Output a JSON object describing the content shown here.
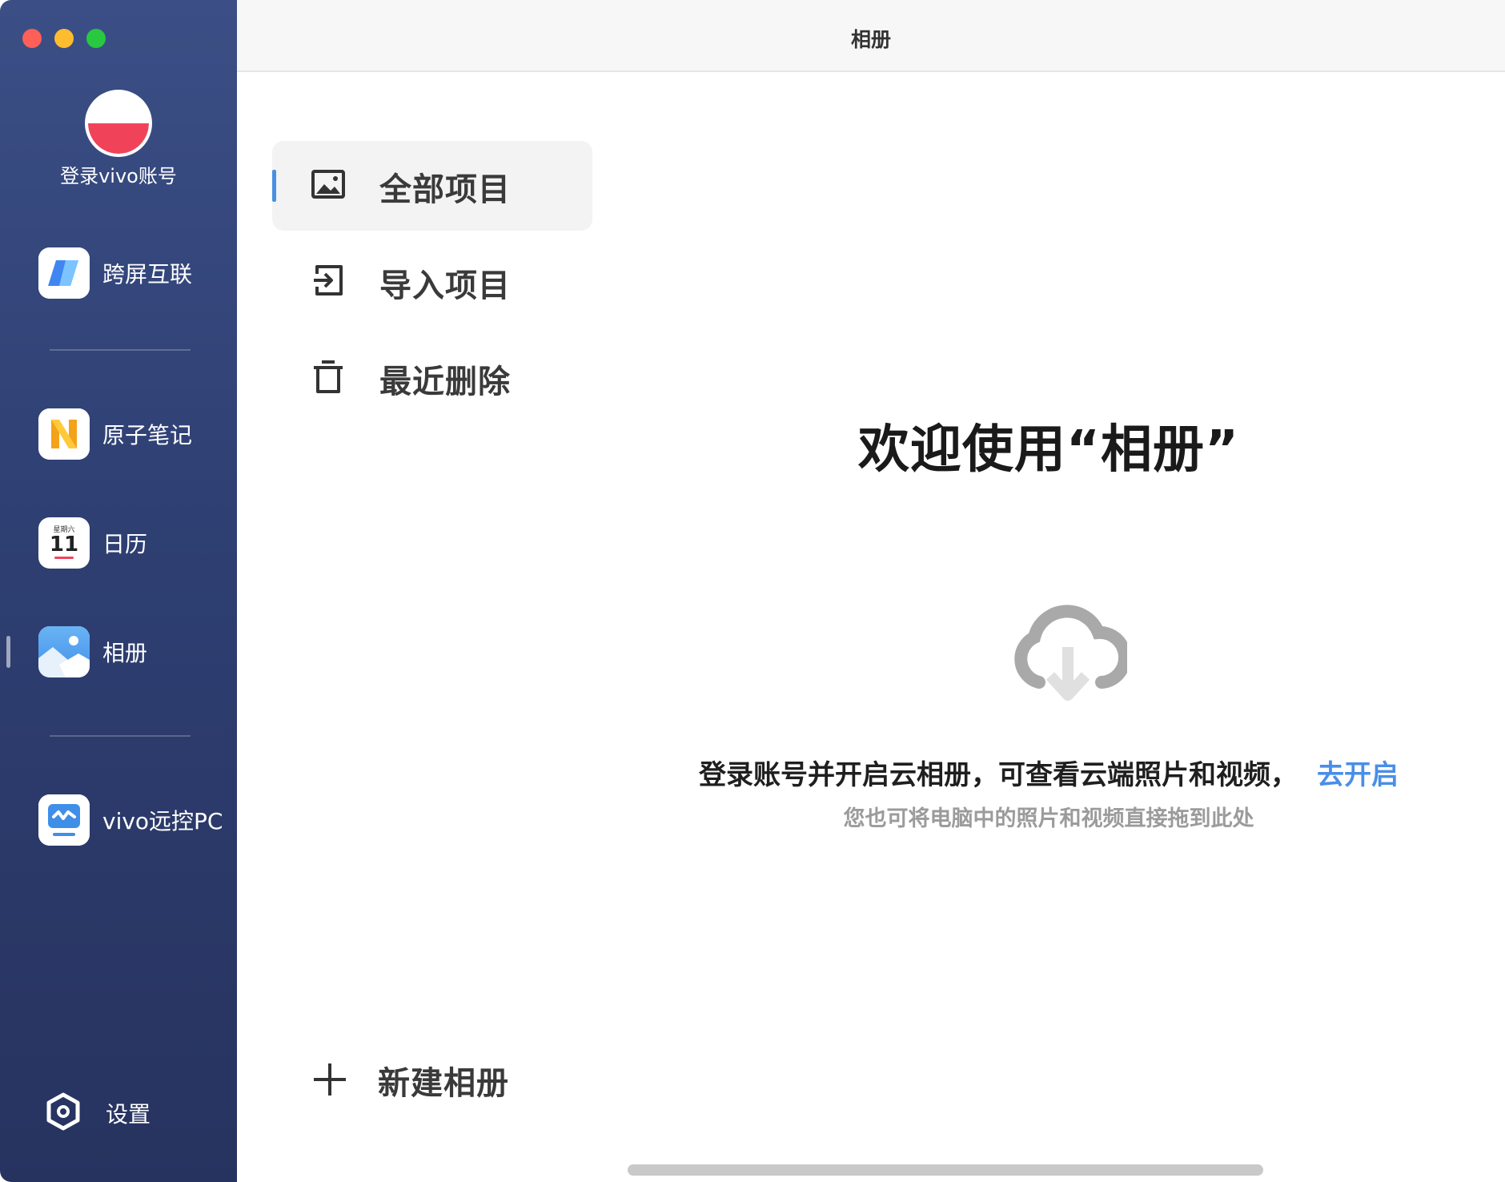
{
  "window": {
    "title": "相册",
    "controls": [
      "close",
      "minimize",
      "zoom"
    ]
  },
  "colors": {
    "sidebar_top": "#3b4f86",
    "sidebar_bottom": "#27335f",
    "accent_link": "#4a8ee8",
    "selection_bar": "#4a90e2"
  },
  "sidebar": {
    "account_label": "登录vivo账号",
    "items": [
      {
        "label": "跨屏互联",
        "icon": "cross-screen-icon"
      },
      {
        "label": "原子笔记",
        "icon": "atom-notes-icon"
      },
      {
        "label": "日历",
        "icon": "calendar-icon",
        "calendar_weekday": "星期六",
        "calendar_day": "11"
      },
      {
        "label": "相册",
        "icon": "photos-icon",
        "active": true
      },
      {
        "label": "vivo远控PC",
        "icon": "remote-pc-icon"
      }
    ],
    "settings_label": "设置"
  },
  "albums": {
    "items": [
      {
        "label": "全部项目",
        "icon": "image-icon",
        "selected": true
      },
      {
        "label": "导入项目",
        "icon": "import-icon"
      },
      {
        "label": "最近删除",
        "icon": "trash-icon"
      }
    ],
    "new_album_label": "新建相册"
  },
  "main": {
    "welcome_title": "欢迎使用“相册”",
    "prompt_text": "登录账号并开启云相册，可查看云端照片和视频，",
    "prompt_link": "去开启",
    "sub_text": "您也可将电脑中的照片和视频直接拖到此处"
  }
}
